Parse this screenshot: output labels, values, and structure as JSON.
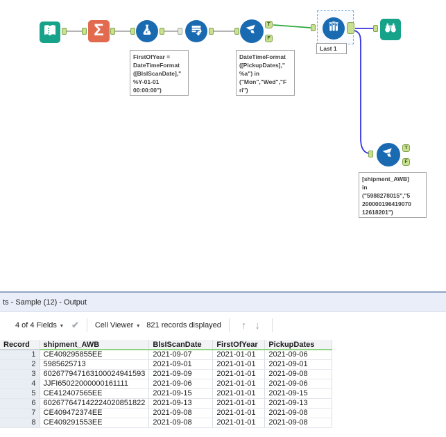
{
  "canvas": {
    "annotations": {
      "formula": "FirstOfYear =\nDateTimeFormat\n([BlsIScanDate],\"\n%Y-01-01\n00:00:00\")",
      "filter1": "DateTimeFormat\n([PickupDates],\"\n%a\") in\n(\"Mon\",\"Wed\",\"F\nri\")",
      "filter2": "[shipment_AWB]\nin\n(\"5988278015\",\"5\n200000196419070\n12618201\")",
      "sample": "Last 1"
    },
    "anchor_labels": {
      "true": "T",
      "false": "F"
    },
    "icons": {
      "sigma": "Σ"
    },
    "colors": {
      "tool_teal": "#17A28A",
      "tool_orange": "#E26A4F",
      "tool_blue": "#1A6AB2",
      "anchor_green": "#C9E08F",
      "wire_gray": "#9B9B9B",
      "wire_green": "#2DA840",
      "wire_blue": "#3434E0",
      "selection_blue": "#6FA8DC"
    }
  },
  "results": {
    "title": "ts - Sample (12) - Output",
    "toolbar": {
      "fields_dropdown": "4 of 4 Fields",
      "cell_viewer": "Cell Viewer",
      "records": "821 records displayed",
      "icons": {
        "dropdown": "▾",
        "check": "✔",
        "up": "↑",
        "down": "↓"
      }
    },
    "table": {
      "header_accent": "#8CD47E",
      "columns": [
        "Record",
        "shipment_AWB",
        "BlsIScanDate",
        "FirstOfYear",
        "PickupDates"
      ],
      "rows": [
        [
          "1",
          "CE409295855EE",
          "2021-09-07",
          "2021-01-01",
          "2021-09-06"
        ],
        [
          "2",
          "5985625713",
          "2021-09-01",
          "2021-01-01",
          "2021-09-01"
        ],
        [
          "3",
          "602677947163100024941593",
          "2021-09-09",
          "2021-01-01",
          "2021-09-08"
        ],
        [
          "4",
          "JJFI65022000000161111",
          "2021-09-06",
          "2021-01-01",
          "2021-09-06"
        ],
        [
          "5",
          "CE412407565EE",
          "2021-09-15",
          "2021-01-01",
          "2021-09-15"
        ],
        [
          "6",
          "602677647142224020851822",
          "2021-09-13",
          "2021-01-01",
          "2021-09-13"
        ],
        [
          "7",
          "CE409472374EE",
          "2021-09-08",
          "2021-01-01",
          "2021-09-08"
        ],
        [
          "8",
          "CE409291553EE",
          "2021-09-08",
          "2021-01-01",
          "2021-09-08"
        ]
      ]
    }
  }
}
